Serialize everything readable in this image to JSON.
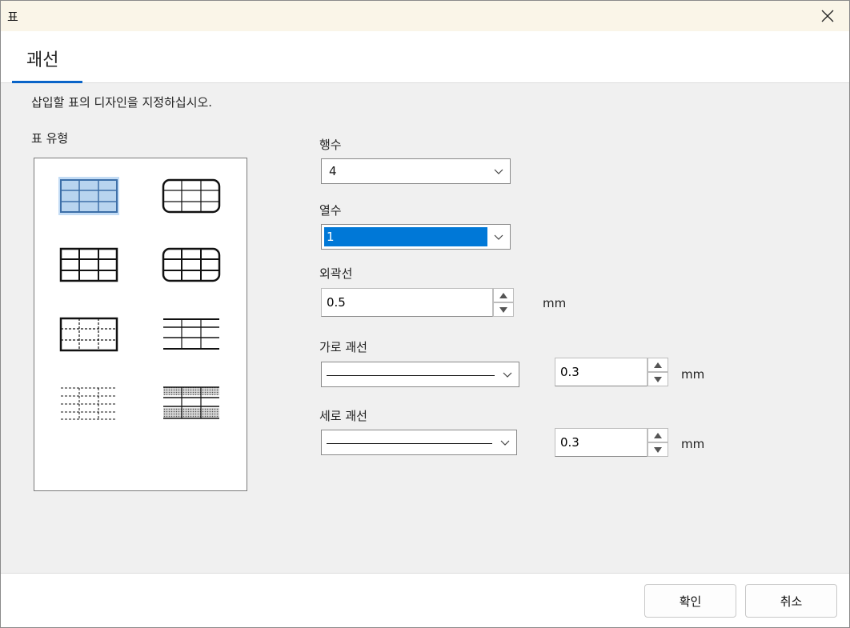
{
  "window": {
    "title": "표"
  },
  "tabs": [
    {
      "label": "괘선",
      "active": true
    }
  ],
  "instruction": "삽입할 표의 디자인을 지정하십시오.",
  "table_type": {
    "label": "표 유형",
    "styles": [
      {
        "name": "grid-filled",
        "selected": true
      },
      {
        "name": "grid-rounded",
        "selected": false
      },
      {
        "name": "grid-bold",
        "selected": false
      },
      {
        "name": "grid-rounded-bold",
        "selected": false
      },
      {
        "name": "grid-dashed-inner",
        "selected": false
      },
      {
        "name": "horizontal-lines",
        "selected": false
      },
      {
        "name": "dashed-all",
        "selected": false
      },
      {
        "name": "shaded-bands",
        "selected": false
      }
    ]
  },
  "rows": {
    "label": "행수",
    "value": "4"
  },
  "columns": {
    "label": "열수",
    "value": "1"
  },
  "outline": {
    "label": "외곽선",
    "value": "0.5",
    "unit": "mm"
  },
  "horizontal_line": {
    "label": "가로 괘선",
    "value": "0.3",
    "unit": "mm"
  },
  "vertical_line": {
    "label": "세로 괘선",
    "value": "0.3",
    "unit": "mm"
  },
  "buttons": {
    "ok": "확인",
    "cancel": "취소"
  },
  "colors": {
    "accent": "#0a64c8",
    "selection": "#0078d7",
    "title_bar": "#faf5e8"
  }
}
